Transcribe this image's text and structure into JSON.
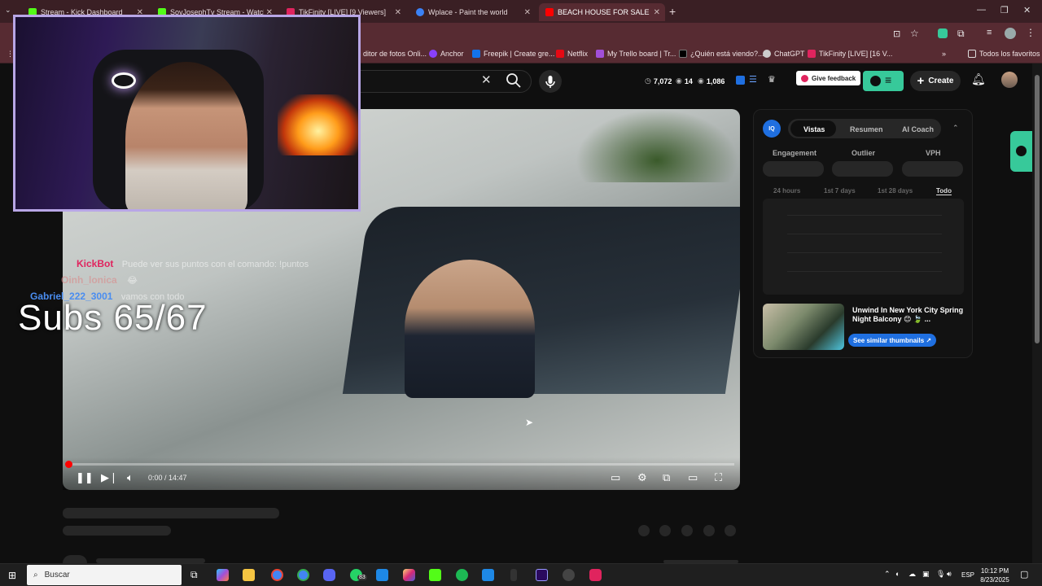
{
  "browser": {
    "tabs": [
      {
        "label": "Stream - Kick Dashboard",
        "color": "#53fc18",
        "active": false
      },
      {
        "label": "SoyJosephTv Stream - Watch Li",
        "color": "#53fc18",
        "active": false
      },
      {
        "label": "TikFinity [LIVE] [9 Viewers]",
        "color": "#e0245e",
        "active": false
      },
      {
        "label": "Wplace - Paint the world",
        "color": "#3b82f6",
        "active": false
      },
      {
        "label": "BEACH HOUSE FOR SALE in",
        "color": "#ff0000",
        "active": true
      }
    ],
    "new_tab": "+",
    "bookmarks": [
      {
        "label": "ditor de fotos Onli...",
        "color": "#888888"
      },
      {
        "label": "Anchor",
        "color": "#8940fa"
      },
      {
        "label": "Freepik | Create gre...",
        "color": "#1273eb"
      },
      {
        "label": "Netflix",
        "color": "#e50914"
      },
      {
        "label": "My Trello board | Tr...",
        "color": "#a14fd8"
      },
      {
        "label": "¿Quién está viendo?...",
        "color": "#000000"
      },
      {
        "label": "ChatGPT",
        "color": "#cccccc"
      },
      {
        "label": "TikFinity [LIVE] [16 V...",
        "color": "#e0245e"
      },
      {
        "label": "Todos los favoritos",
        "color": "#888888"
      }
    ]
  },
  "youtube": {
    "stats": {
      "views": "7,072",
      "likes": "14",
      "subs": "1,086"
    },
    "feedback_label": "Give feedback",
    "create_label": "Create",
    "video": {
      "time": "0:00 / 14:47"
    }
  },
  "overlay": {
    "chat": [
      {
        "name": "KickBot",
        "name_color": "#e0245e",
        "message": "Puede ver sus puntos con el comando: !puntos"
      },
      {
        "name": "Oinh_lonica",
        "name_color": "#d98a8a",
        "message": "😂"
      },
      {
        "name": "Gabriel_222_3001",
        "name_color": "#4a8df0",
        "message": "vamos con todo"
      }
    ],
    "subs_text": "Subs 65/67"
  },
  "vidiq": {
    "logo": "IQ",
    "tabs": [
      "Vistas",
      "Resumen",
      "AI Coach"
    ],
    "active_tab": "Vistas",
    "metrics": [
      "Engagement",
      "Outlier",
      "VPH"
    ],
    "ranges": [
      "24 hours",
      "1st 7 days",
      "1st 28 days",
      "Todo"
    ],
    "active_range": "Todo",
    "suggestion_title": "Unwind In New York City Spring Night Balcony 😊 🍃 ...",
    "similar_label": "See similar thumbnails ↗"
  },
  "taskbar": {
    "search_placeholder": "Buscar",
    "whatsapp_badge": "83",
    "lang": "ESP",
    "time": "10:12 PM",
    "date": "8/23/2025"
  }
}
